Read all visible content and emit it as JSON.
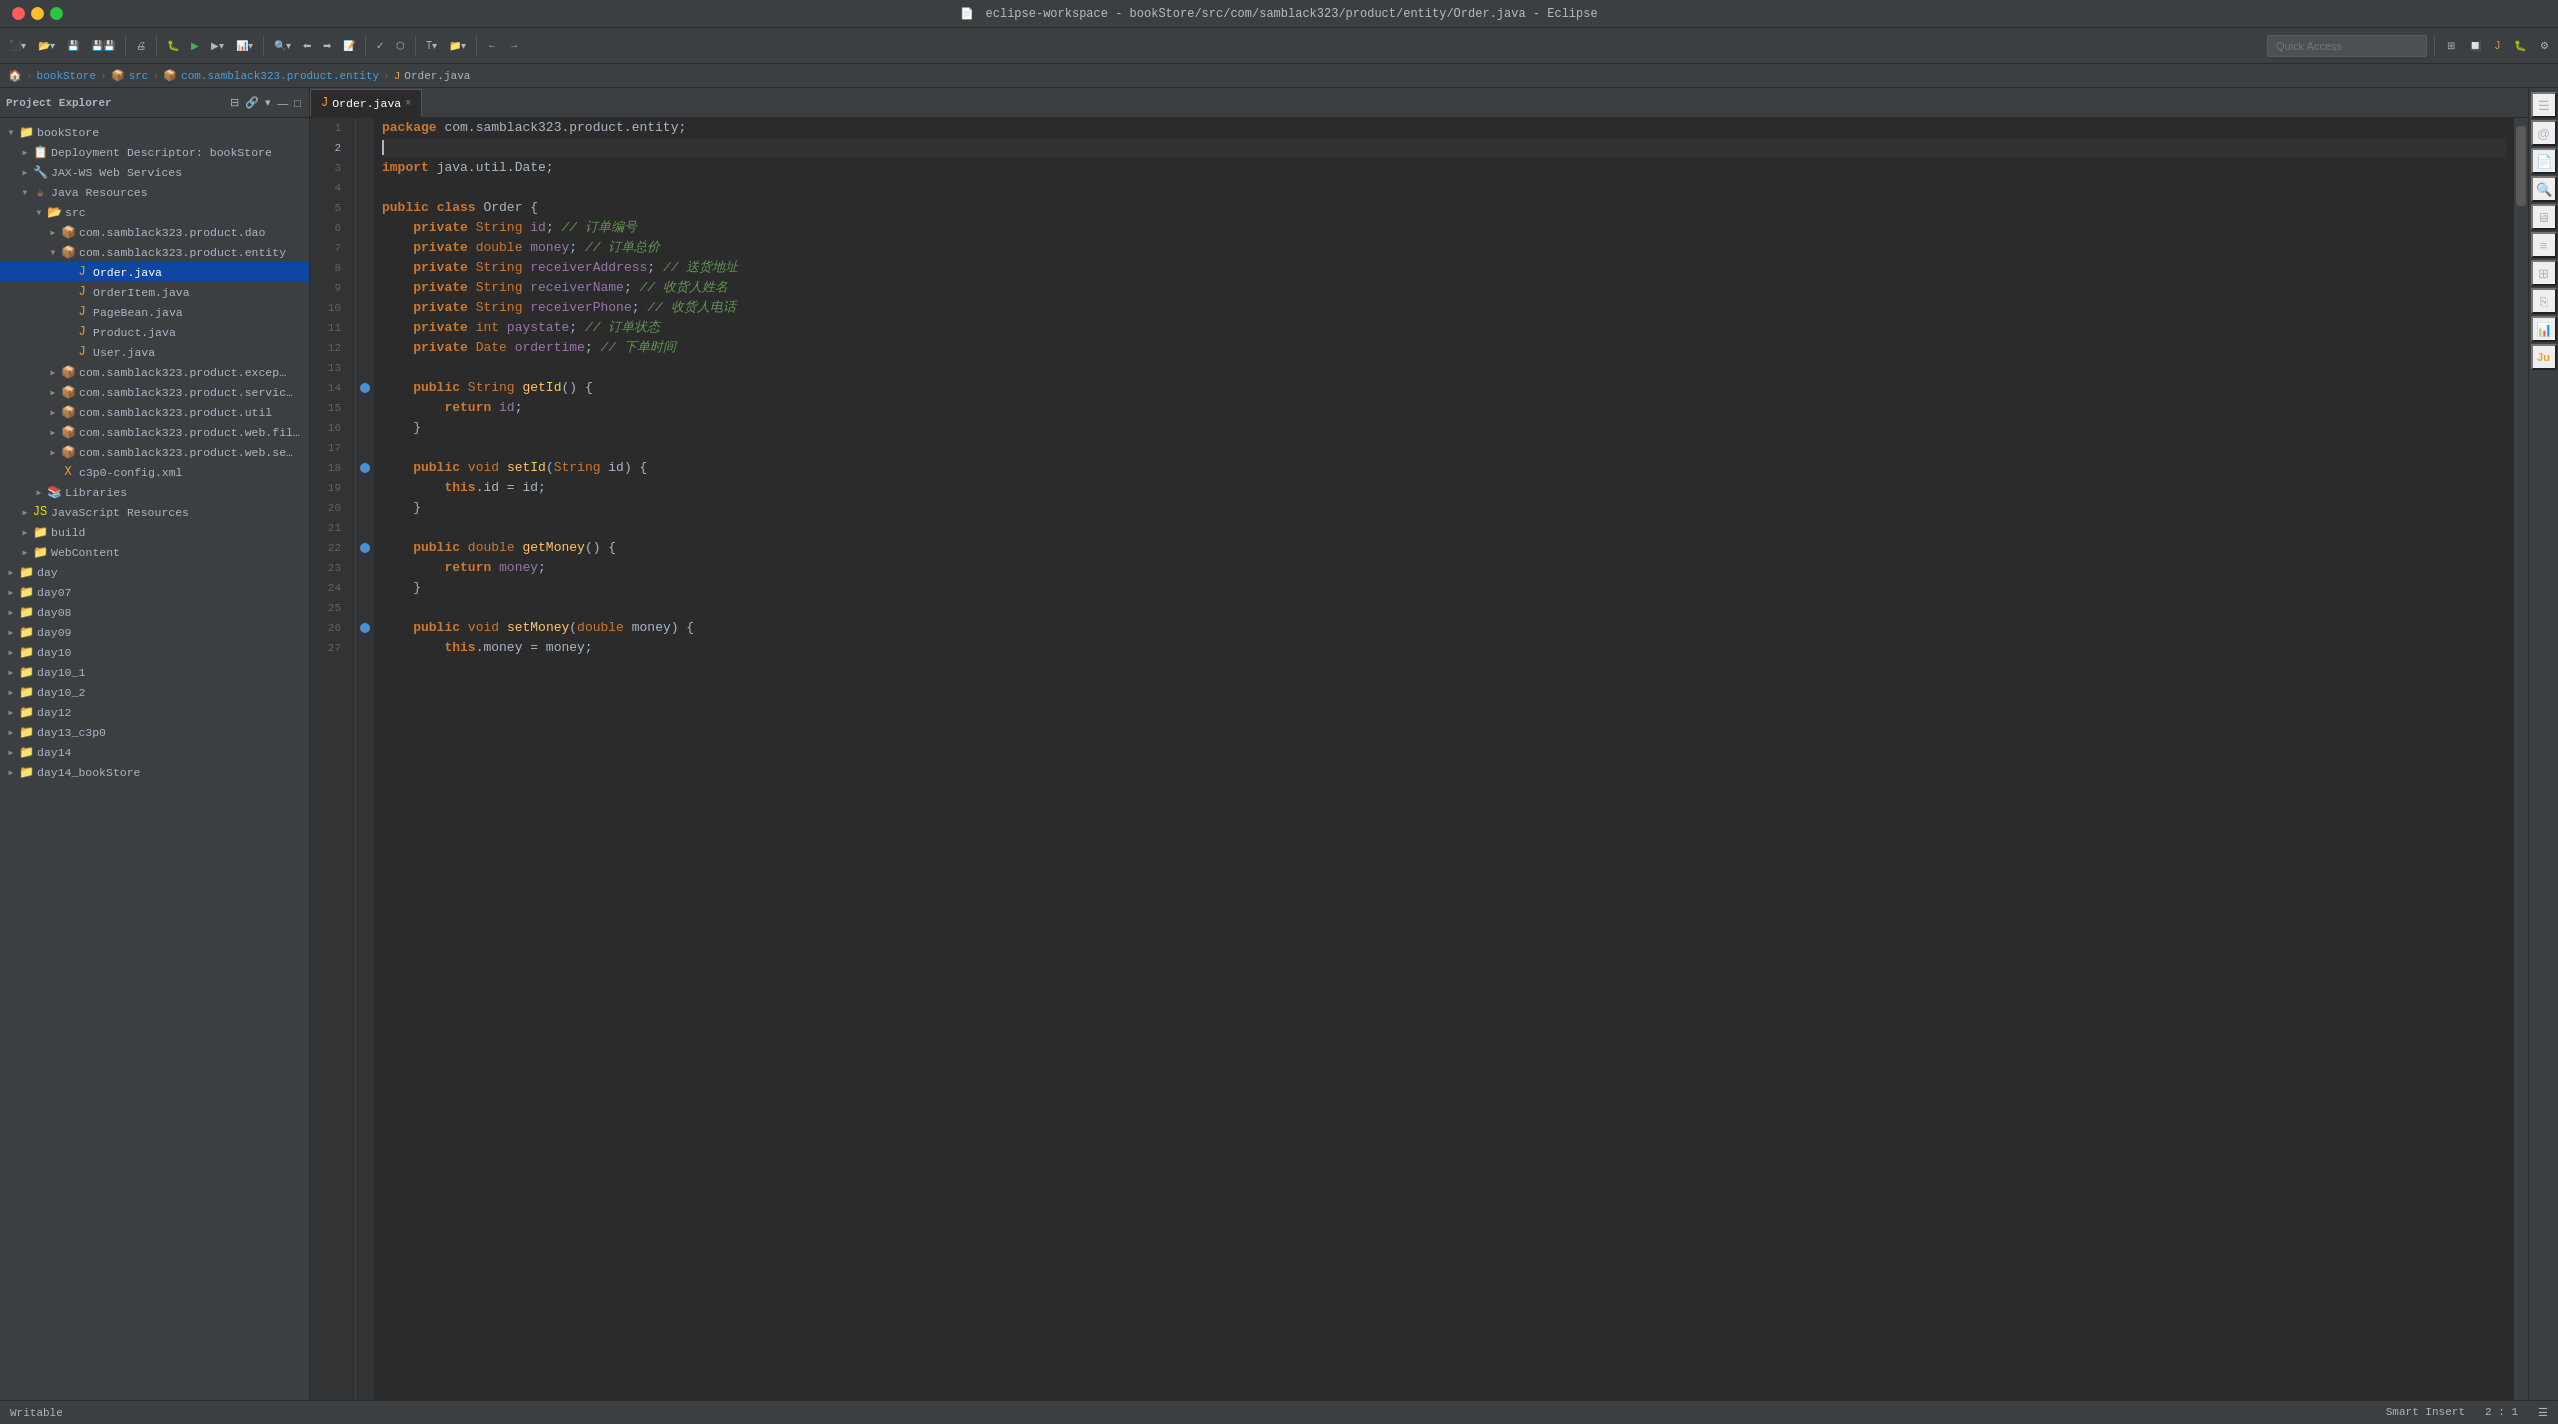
{
  "window": {
    "title": "eclipse-workspace - bookStore/src/com/samblack323/product/entity/Order.java - Eclipse"
  },
  "toolbar": {
    "quick_access_placeholder": "Quick Access"
  },
  "breadcrumb": {
    "items": [
      "bookStore",
      "src",
      "com.samblack323.product.entity",
      "Order.java"
    ]
  },
  "project_explorer": {
    "title": "Project Explorer",
    "tree": [
      {
        "level": 0,
        "expanded": true,
        "label": "bookStore",
        "type": "project",
        "arrow": "▼"
      },
      {
        "level": 1,
        "expanded": false,
        "label": "Deployment Descriptor: bookStore",
        "type": "descriptor",
        "arrow": "▶"
      },
      {
        "level": 1,
        "expanded": false,
        "label": "JAX-WS Web Services",
        "type": "services",
        "arrow": "▶"
      },
      {
        "level": 1,
        "expanded": true,
        "label": "Java Resources",
        "type": "java-resources",
        "arrow": "▼"
      },
      {
        "level": 2,
        "expanded": true,
        "label": "src",
        "type": "folder",
        "arrow": "▼"
      },
      {
        "level": 3,
        "expanded": false,
        "label": "com.samblack323.product.dao",
        "type": "package",
        "arrow": "▶"
      },
      {
        "level": 3,
        "expanded": true,
        "label": "com.samblack323.product.entity",
        "type": "package",
        "arrow": "▼"
      },
      {
        "level": 4,
        "expanded": false,
        "label": "Order.java",
        "type": "java",
        "arrow": "",
        "selected": true
      },
      {
        "level": 4,
        "expanded": false,
        "label": "OrderItem.java",
        "type": "java",
        "arrow": ""
      },
      {
        "level": 4,
        "expanded": false,
        "label": "PageBean.java",
        "type": "java",
        "arrow": ""
      },
      {
        "level": 4,
        "expanded": false,
        "label": "Product.java",
        "type": "java",
        "arrow": ""
      },
      {
        "level": 4,
        "expanded": false,
        "label": "User.java",
        "type": "java",
        "arrow": ""
      },
      {
        "level": 3,
        "expanded": false,
        "label": "com.samblack323.product.excep…",
        "type": "package",
        "arrow": "▶"
      },
      {
        "level": 3,
        "expanded": false,
        "label": "com.samblack323.product.servic…",
        "type": "package",
        "arrow": "▶"
      },
      {
        "level": 3,
        "expanded": false,
        "label": "com.samblack323.product.util",
        "type": "package",
        "arrow": "▶"
      },
      {
        "level": 3,
        "expanded": false,
        "label": "com.samblack323.product.web.fil…",
        "type": "package",
        "arrow": "▶"
      },
      {
        "level": 3,
        "expanded": false,
        "label": "com.samblack323.product.web.se…",
        "type": "package",
        "arrow": "▶"
      },
      {
        "level": 3,
        "expanded": false,
        "label": "c3p0-config.xml",
        "type": "xml",
        "arrow": ""
      },
      {
        "level": 2,
        "expanded": false,
        "label": "Libraries",
        "type": "libraries",
        "arrow": "▶"
      },
      {
        "level": 1,
        "expanded": false,
        "label": "JavaScript Resources",
        "type": "js-resources",
        "arrow": "▶"
      },
      {
        "level": 1,
        "expanded": false,
        "label": "build",
        "type": "folder-plain",
        "arrow": "▶"
      },
      {
        "level": 1,
        "expanded": false,
        "label": "WebContent",
        "type": "folder-plain",
        "arrow": "▶"
      },
      {
        "level": 0,
        "expanded": false,
        "label": "day",
        "type": "folder-plain",
        "arrow": "▶"
      },
      {
        "level": 0,
        "expanded": false,
        "label": "day07",
        "type": "folder-plain",
        "arrow": "▶"
      },
      {
        "level": 0,
        "expanded": false,
        "label": "day08",
        "type": "folder-plain",
        "arrow": "▶"
      },
      {
        "level": 0,
        "expanded": false,
        "label": "day09",
        "type": "folder-plain",
        "arrow": "▶"
      },
      {
        "level": 0,
        "expanded": false,
        "label": "day10",
        "type": "folder-plain",
        "arrow": "▶"
      },
      {
        "level": 0,
        "expanded": false,
        "label": "day10_1",
        "type": "folder-plain",
        "arrow": "▶"
      },
      {
        "level": 0,
        "expanded": false,
        "label": "day10_2",
        "type": "folder-plain",
        "arrow": "▶"
      },
      {
        "level": 0,
        "expanded": false,
        "label": "day12",
        "type": "folder-plain",
        "arrow": "▶"
      },
      {
        "level": 0,
        "expanded": false,
        "label": "day13_c3p0",
        "type": "folder-plain",
        "arrow": "▶"
      },
      {
        "level": 0,
        "expanded": false,
        "label": "day14",
        "type": "folder-plain",
        "arrow": "▶"
      },
      {
        "level": 0,
        "expanded": false,
        "label": "day14_bookStore",
        "type": "folder-plain",
        "arrow": "▶"
      }
    ]
  },
  "editor": {
    "tab_label": "Order.java",
    "tab_close": "×",
    "filename": "Order.java"
  },
  "code_lines": [
    {
      "num": 1,
      "content": "package com.samblack323.product.entity;"
    },
    {
      "num": 2,
      "content": ""
    },
    {
      "num": 3,
      "content": "import java.util.Date;"
    },
    {
      "num": 4,
      "content": ""
    },
    {
      "num": 5,
      "content": "public class Order {"
    },
    {
      "num": 6,
      "content": "    private String id; // 订单编号"
    },
    {
      "num": 7,
      "content": "    private double money; // 订单总价"
    },
    {
      "num": 8,
      "content": "    private String receiverAddress; // 送货地址"
    },
    {
      "num": 9,
      "content": "    private String receiverName; // 收货人姓名"
    },
    {
      "num": 10,
      "content": "    private String receiverPhone; // 收货人电话"
    },
    {
      "num": 11,
      "content": "    private int paystate; // 订单状态"
    },
    {
      "num": 12,
      "content": "    private Date ordertime; // 下单时间"
    },
    {
      "num": 13,
      "content": ""
    },
    {
      "num": 14,
      "content": "    public String getId() {",
      "has_marker": true
    },
    {
      "num": 15,
      "content": "        return id;"
    },
    {
      "num": 16,
      "content": "    }"
    },
    {
      "num": 17,
      "content": ""
    },
    {
      "num": 18,
      "content": "    public void setId(String id) {",
      "has_marker": true
    },
    {
      "num": 19,
      "content": "        this.id = id;"
    },
    {
      "num": 20,
      "content": "    }"
    },
    {
      "num": 21,
      "content": ""
    },
    {
      "num": 22,
      "content": "    public double getMoney() {",
      "has_marker": true
    },
    {
      "num": 23,
      "content": "        return money;"
    },
    {
      "num": 24,
      "content": "    }"
    },
    {
      "num": 25,
      "content": ""
    },
    {
      "num": 26,
      "content": "    public void setMoney(double money) {",
      "has_marker": true
    },
    {
      "num": 27,
      "content": "        this.money = money;"
    }
  ],
  "status_bar": {
    "writable": "Writable",
    "smart_insert": "Smart Insert",
    "position": "2 : 1"
  }
}
